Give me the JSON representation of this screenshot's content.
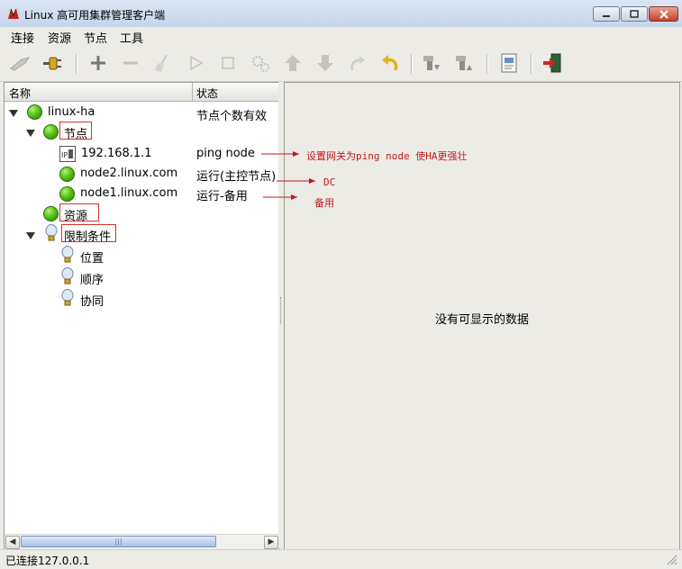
{
  "window": {
    "title": "Linux 高可用集群管理客户端"
  },
  "menu": [
    {
      "label": "连接"
    },
    {
      "label": "资源"
    },
    {
      "label": "节点"
    },
    {
      "label": "工具"
    }
  ],
  "toolbar_icons": [
    "connect-icon",
    "plug-icon",
    "add-icon",
    "remove-icon",
    "cleanup-broom-icon",
    "start-icon",
    "stop-icon",
    "gears-icon",
    "move-up-icon",
    "move-down-icon",
    "redo-icon",
    "undo-icon",
    "standby-node-icon",
    "active-node-icon",
    "document-icon",
    "exit-icon"
  ],
  "tree": {
    "headers": {
      "name": "名称",
      "status": "状态"
    },
    "root": {
      "label": "linux-ha",
      "status": "节点个数有效"
    },
    "nodes_group": {
      "label": "节点"
    },
    "nodes": [
      {
        "label": "192.168.1.1",
        "status": "ping node"
      },
      {
        "label": "node2.linux.com",
        "status": "运行(主控节点)"
      },
      {
        "label": "node1.linux.com",
        "status": "运行-备用"
      }
    ],
    "resources": {
      "label": "资源"
    },
    "constraints": {
      "label": "限制条件"
    },
    "constraint_items": [
      {
        "label": "位置"
      },
      {
        "label": "顺序"
      },
      {
        "label": "协同"
      }
    ]
  },
  "right_panel": {
    "empty_message": "没有可显示的数据"
  },
  "status_bar": {
    "text": "已连接127.0.0.1"
  },
  "annotations": [
    {
      "text": "设置网关为ping node 使HA更强壮"
    },
    {
      "text": "DC"
    },
    {
      "text": "备用"
    }
  ],
  "colors": {
    "annotation": "#c11a1a",
    "node_online": "#5fcb1e"
  }
}
